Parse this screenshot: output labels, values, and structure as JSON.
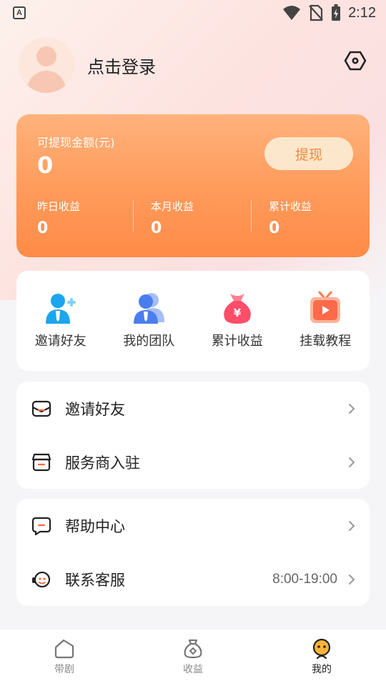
{
  "status_bar": {
    "time": "2:12",
    "app_badge": "A"
  },
  "profile": {
    "login_text": "点击登录"
  },
  "wallet": {
    "withdrawable_label": "可提现金额(元)",
    "withdrawable_amount": "0",
    "withdraw_button": "提现",
    "stats": [
      {
        "label": "昨日收益",
        "value": "0"
      },
      {
        "label": "本月收益",
        "value": "0"
      },
      {
        "label": "累计收益",
        "value": "0"
      }
    ]
  },
  "quick_actions": [
    {
      "label": "邀请好友",
      "icon": "invite-friend-icon"
    },
    {
      "label": "我的团队",
      "icon": "team-icon"
    },
    {
      "label": "累计收益",
      "icon": "money-bag-icon"
    },
    {
      "label": "挂载教程",
      "icon": "video-tutorial-icon"
    }
  ],
  "menu_group_1": [
    {
      "label": "邀请好友",
      "icon": "envelope-icon"
    },
    {
      "label": "服务商入驻",
      "icon": "store-icon"
    }
  ],
  "menu_group_2": [
    {
      "label": "帮助中心",
      "icon": "help-chat-icon",
      "extra": ""
    },
    {
      "label": "联系客服",
      "icon": "customer-service-icon",
      "extra": "8:00-19:00"
    }
  ],
  "tab_bar": [
    {
      "label": "带剧",
      "icon": "drama-icon",
      "active": false
    },
    {
      "label": "收益",
      "icon": "earnings-bag-icon",
      "active": false
    },
    {
      "label": "我的",
      "icon": "profile-face-icon",
      "active": true
    }
  ],
  "colors": {
    "accent": "#ff9a5a",
    "wallet_button_bg": "#fde7cc",
    "wallet_button_text": "#f08a3e"
  }
}
